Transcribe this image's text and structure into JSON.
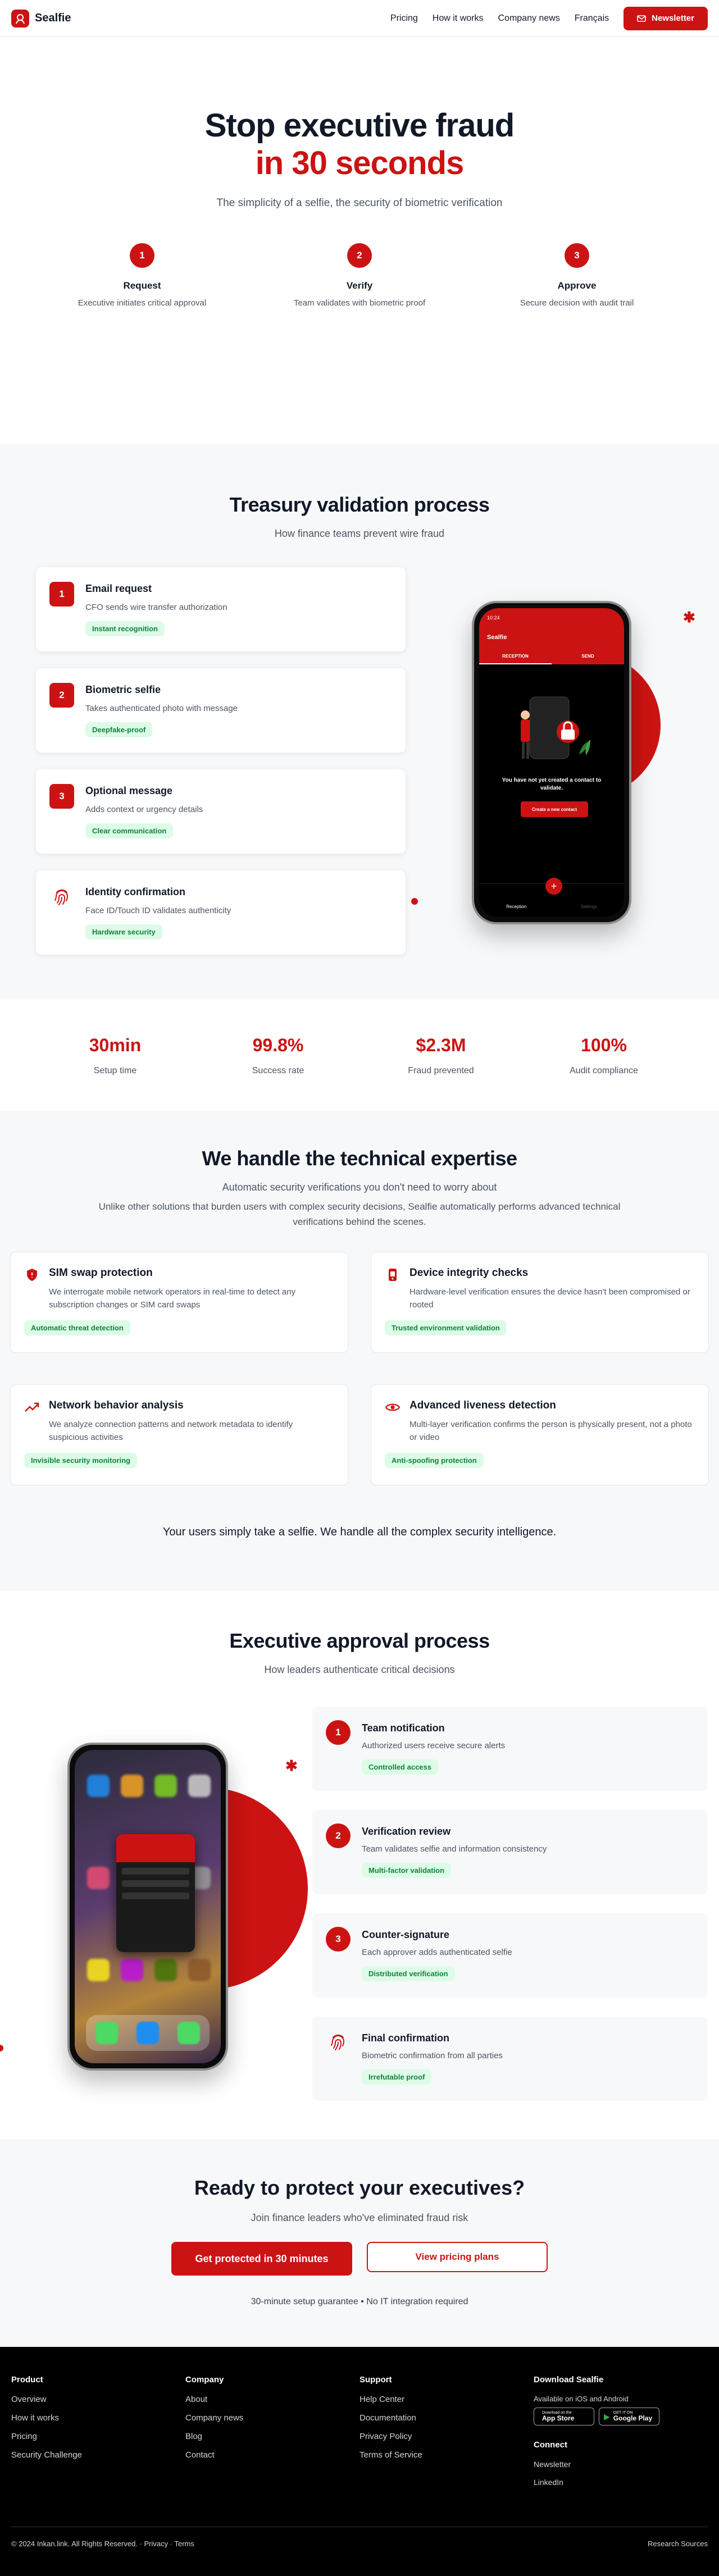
{
  "header": {
    "brand": "Sealfie",
    "nav": [
      "Pricing",
      "How it works",
      "Company news",
      "Français"
    ],
    "newsletter_label": "Newsletter"
  },
  "hero": {
    "title_line1": "Stop executive fraud",
    "title_line2": "in 30 seconds",
    "subtitle": "The simplicity of a selfie, the security of biometric verification",
    "steps": [
      {
        "num": "1",
        "title": "Request",
        "desc": "Executive initiates critical approval"
      },
      {
        "num": "2",
        "title": "Verify",
        "desc": "Team validates with biometric proof"
      },
      {
        "num": "3",
        "title": "Approve",
        "desc": "Secure decision with audit trail"
      }
    ]
  },
  "treasury": {
    "title": "Treasury validation process",
    "subtitle": "How finance teams prevent wire fraud",
    "cards": [
      {
        "num": "1",
        "title": "Email request",
        "desc": "CFO sends wire transfer authorization",
        "tag": "Instant recognition"
      },
      {
        "num": "2",
        "title": "Biometric selfie",
        "desc": "Takes authenticated photo with message",
        "tag": "Deepfake-proof"
      },
      {
        "num": "3",
        "title": "Optional message",
        "desc": "Adds context or urgency details",
        "tag": "Clear communication"
      },
      {
        "title": "Identity confirmation",
        "desc": "Face ID/Touch ID validates authenticity",
        "tag": "Hardware security"
      }
    ],
    "phone": {
      "time": "10:24",
      "app_title": "Sealfie",
      "tabs": [
        "RECEPTION",
        "SEND"
      ],
      "empty_text": "You have not yet created a contact to validate.",
      "button": "Create a new contact",
      "bottom_tabs": [
        "Reception",
        "Settings"
      ]
    }
  },
  "stats": [
    {
      "value": "30min",
      "label": "Setup time"
    },
    {
      "value": "99.8%",
      "label": "Success rate"
    },
    {
      "value": "$2.3M",
      "label": "Fraud prevented"
    },
    {
      "value": "100%",
      "label": "Audit compliance"
    }
  ],
  "expertise": {
    "title": "We handle the technical expertise",
    "subtitle": "Automatic security verifications you don't need to worry about",
    "paragraph": "Unlike other solutions that burden users with complex security decisions, Sealfie automatically performs advanced technical verifications behind the scenes.",
    "features": [
      {
        "icon": "shield-icon",
        "title": "SIM swap protection",
        "desc": "We interrogate mobile network operators in real-time to detect any subscription changes or SIM card swaps",
        "tag": "Automatic threat detection"
      },
      {
        "icon": "device-icon",
        "title": "Device integrity checks",
        "desc": "Hardware-level verification ensures the device hasn't been compromised or rooted",
        "tag": "Trusted environment validation"
      },
      {
        "icon": "trend-icon",
        "title": "Network behavior analysis",
        "desc": "We analyze connection patterns and network metadata to identify suspicious activities",
        "tag": "Invisible security monitoring"
      },
      {
        "icon": "eye-icon",
        "title": "Advanced liveness detection",
        "desc": "Multi-layer verification confirms the person is physically present, not a photo or video",
        "tag": "Anti-spoofing protection"
      }
    ],
    "closing": "Your users simply take a selfie. We handle all the complex security intelligence."
  },
  "executive": {
    "title": "Executive approval process",
    "subtitle": "How leaders authenticate critical decisions",
    "cards": [
      {
        "num": "1",
        "title": "Team notification",
        "desc": "Authorized users receive secure alerts",
        "tag": "Controlled access"
      },
      {
        "num": "2",
        "title": "Verification review",
        "desc": "Team validates selfie and information consistency",
        "tag": "Multi-factor validation"
      },
      {
        "num": "3",
        "title": "Counter-signature",
        "desc": "Each approver adds authenticated selfie",
        "tag": "Distributed verification"
      },
      {
        "title": "Final confirmation",
        "desc": "Biometric confirmation from all parties",
        "tag": "Irrefutable proof"
      }
    ]
  },
  "cta": {
    "title": "Ready to protect your executives?",
    "subtitle": "Join finance leaders who've eliminated fraud risk",
    "primary": "Get protected in 30 minutes",
    "secondary": "View pricing plans",
    "guarantee": "30-minute setup guarantee • No IT integration required"
  },
  "footer": {
    "columns": [
      {
        "title": "Product",
        "links": [
          "Overview",
          "How it works",
          "Pricing",
          "Security Challenge"
        ]
      },
      {
        "title": "Company",
        "links": [
          "About",
          "Company news",
          "Blog",
          "Contact"
        ]
      },
      {
        "title": "Support",
        "links": [
          "Help Center",
          "Documentation",
          "Privacy Policy",
          "Terms of Service"
        ]
      }
    ],
    "download_title": "Download Sealfie",
    "download_sub": "Available on iOS and Android",
    "appstore_small": "Download on the",
    "appstore": "App Store",
    "googleplay_small": "GET IT ON",
    "googleplay": "Google Play",
    "connect_title": "Connect",
    "connect_links": [
      "Newsletter",
      "LinkedIn"
    ],
    "copyright": "© 2024 Inkan.link. All Rights Reserved.",
    "privacy": "Privacy",
    "terms": "Terms",
    "research": "Research Sources"
  }
}
